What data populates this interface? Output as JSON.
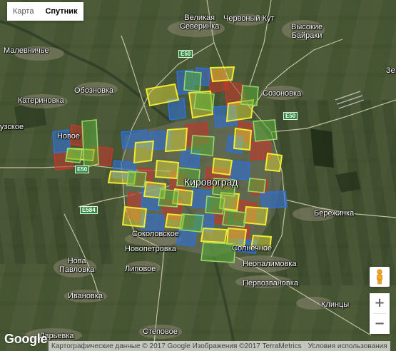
{
  "map_type": {
    "map_label": "Карта",
    "satellite_label": "Спутник",
    "active": "satellite"
  },
  "places": [
    {
      "id": "velikaya-severinka",
      "text": "Великая\nСеверинка"
    },
    {
      "id": "chervony-kut",
      "text": "Червоный Кут"
    },
    {
      "id": "vysokie-bayraki",
      "text": "Высокие\nБайраки"
    },
    {
      "id": "malevnichye",
      "text": "Малевничье"
    },
    {
      "id": "obozovka",
      "text": "Обозновка"
    },
    {
      "id": "sozonovka",
      "text": "Созоновка"
    },
    {
      "id": "katerinovka",
      "text": "Катериновка"
    },
    {
      "id": "uzskoe",
      "text": "узское"
    },
    {
      "id": "novoe",
      "text": "Новое"
    },
    {
      "id": "kirovograd",
      "text": "Кировоград"
    },
    {
      "id": "berezhinka",
      "text": "Бережинка"
    },
    {
      "id": "sokolovskoe",
      "text": "Соколовское"
    },
    {
      "id": "novopetrovka",
      "text": "Новопетровка"
    },
    {
      "id": "solnechnoe",
      "text": "Солнечное"
    },
    {
      "id": "nova-pavlovka",
      "text": "Нова\nПавловка"
    },
    {
      "id": "lipovoe",
      "text": "Липовое"
    },
    {
      "id": "neopalimovka",
      "text": "Неопалимовка"
    },
    {
      "id": "pervozvanovka",
      "text": "Первозвановка"
    },
    {
      "id": "ivanovka",
      "text": "Ивановка"
    },
    {
      "id": "klintsy",
      "text": "Клинцы"
    },
    {
      "id": "daryevka",
      "text": "Дарьевка"
    },
    {
      "id": "stepovoe",
      "text": "Степовое"
    },
    {
      "id": "ze",
      "text": "Зе"
    }
  ],
  "road_shields": [
    "E50",
    "E50",
    "E50",
    "E584"
  ],
  "controls": {
    "zoom_in": "+",
    "zoom_out": "−"
  },
  "logo": "Google",
  "attribution": {
    "data": "Картографические данные © 2017 Google Изображения ©2017 TerraMetrics",
    "terms": "Условия использования"
  },
  "overlay_colors": {
    "red": "#c0392b",
    "blue": "#2f6fd6",
    "yellow": "#e8e23a",
    "green": "#5aab3a"
  }
}
